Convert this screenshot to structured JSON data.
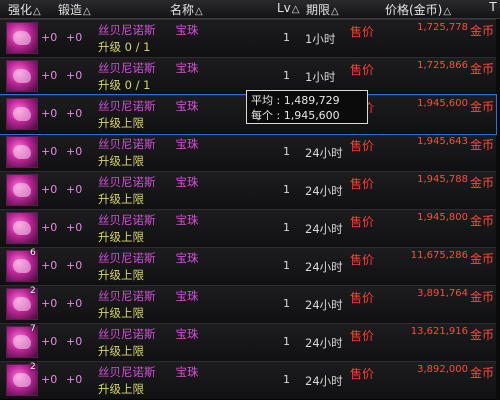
{
  "header": {
    "enhance": "强化",
    "forge": "锻造",
    "name": "名称",
    "level": "Lv",
    "period": "期限",
    "price": "价格(金币)",
    "sort_icon": "△",
    "corner_icon": "T"
  },
  "tooltip": {
    "avg_label": "平均 : 1,489,729",
    "each_label": "每个 : 1,945,600"
  },
  "rows": [
    {
      "enhance": "+0",
      "forge": "+0",
      "name": "丝贝尼诺斯",
      "gem": "宝珠",
      "upgrade": "升级 0 / 1",
      "stack": "",
      "lv": "1",
      "period": "1小时",
      "price_tag": "售价",
      "price": "1,725,778",
      "currency": "金币"
    },
    {
      "enhance": "+0",
      "forge": "+0",
      "name": "丝贝尼诺斯",
      "gem": "宝珠",
      "upgrade": "升级 0 / 1",
      "stack": "",
      "lv": "1",
      "period": "1小时",
      "price_tag": "售价",
      "price": "1,725,866",
      "currency": "金币"
    },
    {
      "enhance": "+0",
      "forge": "+0",
      "name": "丝贝尼诺斯",
      "gem": "宝珠",
      "upgrade": "升级上限",
      "stack": "",
      "lv": "",
      "period": "",
      "price_tag": "售价",
      "price": "1,945,600",
      "currency": "金币"
    },
    {
      "enhance": "+0",
      "forge": "+0",
      "name": "丝贝尼诺斯",
      "gem": "宝珠",
      "upgrade": "升级上限",
      "stack": "",
      "lv": "1",
      "period": "24小时",
      "price_tag": "售价",
      "price": "1,945,643",
      "currency": "金币"
    },
    {
      "enhance": "+0",
      "forge": "+0",
      "name": "丝贝尼诺斯",
      "gem": "宝珠",
      "upgrade": "升级上限",
      "stack": "",
      "lv": "1",
      "period": "24小时",
      "price_tag": "售价",
      "price": "1,945,788",
      "currency": "金币"
    },
    {
      "enhance": "+0",
      "forge": "+0",
      "name": "丝贝尼诺斯",
      "gem": "宝珠",
      "upgrade": "升级上限",
      "stack": "",
      "lv": "1",
      "period": "24小时",
      "price_tag": "售价",
      "price": "1,945,800",
      "currency": "金币"
    },
    {
      "enhance": "+0",
      "forge": "+0",
      "name": "丝贝尼诺斯",
      "gem": "宝珠",
      "upgrade": "升级上限",
      "stack": "6",
      "lv": "1",
      "period": "24小时",
      "price_tag": "售价",
      "price": "11,675,286",
      "currency": "金币"
    },
    {
      "enhance": "+0",
      "forge": "+0",
      "name": "丝贝尼诺斯",
      "gem": "宝珠",
      "upgrade": "升级上限",
      "stack": "2",
      "lv": "1",
      "period": "24小时",
      "price_tag": "售价",
      "price": "3,891,764",
      "currency": "金币"
    },
    {
      "enhance": "+0",
      "forge": "+0",
      "name": "丝贝尼诺斯",
      "gem": "宝珠",
      "upgrade": "升级上限",
      "stack": "7",
      "lv": "1",
      "period": "24小时",
      "price_tag": "售价",
      "price": "13,621,916",
      "currency": "金币"
    },
    {
      "enhance": "+0",
      "forge": "+0",
      "name": "丝贝尼诺斯",
      "gem": "宝珠",
      "upgrade": "升级上限",
      "stack": "2",
      "lv": "1",
      "period": "24小时",
      "price_tag": "售价",
      "price": "3,892,000",
      "currency": "金币"
    }
  ]
}
